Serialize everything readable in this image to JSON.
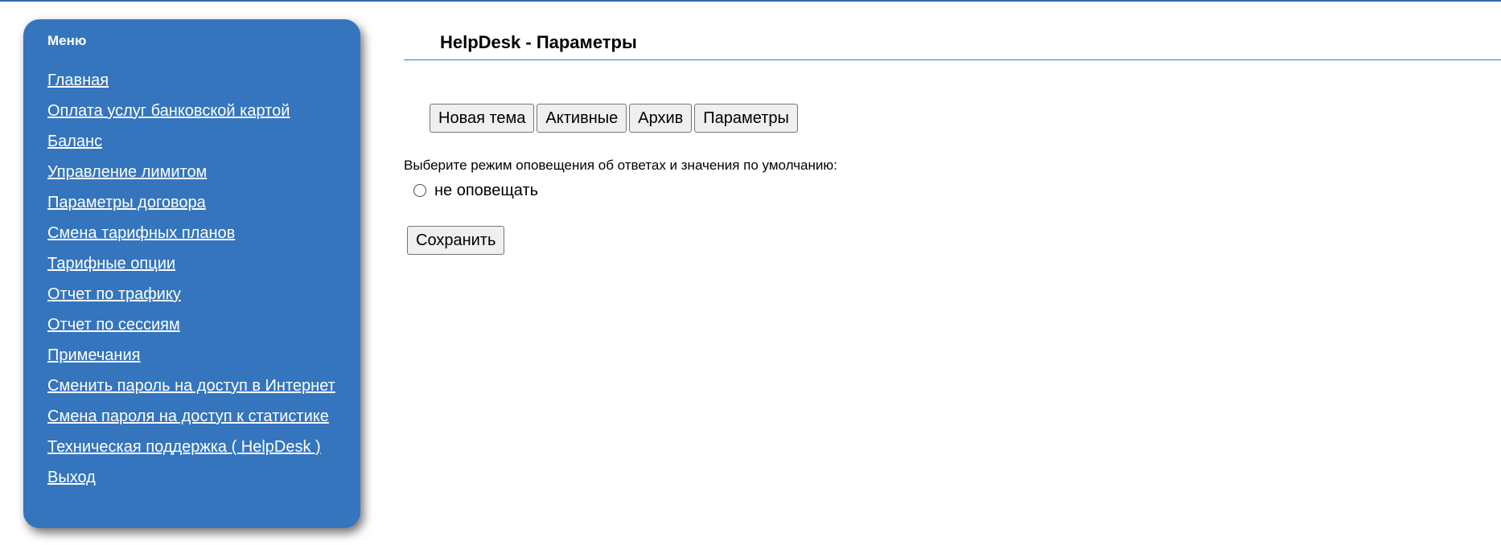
{
  "sidebar": {
    "title": "Меню",
    "items": [
      {
        "label": "Главная"
      },
      {
        "label": "Оплата услуг банковской картой"
      },
      {
        "label": "Баланс"
      },
      {
        "label": "Управление лимитом"
      },
      {
        "label": "Параметры договора"
      },
      {
        "label": "Смена тарифных планов"
      },
      {
        "label": "Тарифные опции"
      },
      {
        "label": "Отчет по трафику"
      },
      {
        "label": "Отчет по сессиям"
      },
      {
        "label": "Примечания"
      },
      {
        "label": "Сменить пароль на доступ в Интернет"
      },
      {
        "label": "Смена пароля на доступ к статистике"
      },
      {
        "label": "Техническая поддержка ( HelpDesk )"
      },
      {
        "label": "Выход"
      }
    ]
  },
  "header": {
    "title": "HelpDesk - Параметры"
  },
  "tabs": [
    {
      "label": "Новая тема"
    },
    {
      "label": "Активные"
    },
    {
      "label": "Архив"
    },
    {
      "label": "Параметры"
    }
  ],
  "notification": {
    "prompt": "Выберите режим оповещения об ответах и значения по умолчанию:",
    "option_label": "не оповещать",
    "option_selected": false
  },
  "actions": {
    "save_label": "Сохранить"
  },
  "colors": {
    "sidebar_bg": "#3475bd",
    "accent_line": "#3a78bd"
  }
}
